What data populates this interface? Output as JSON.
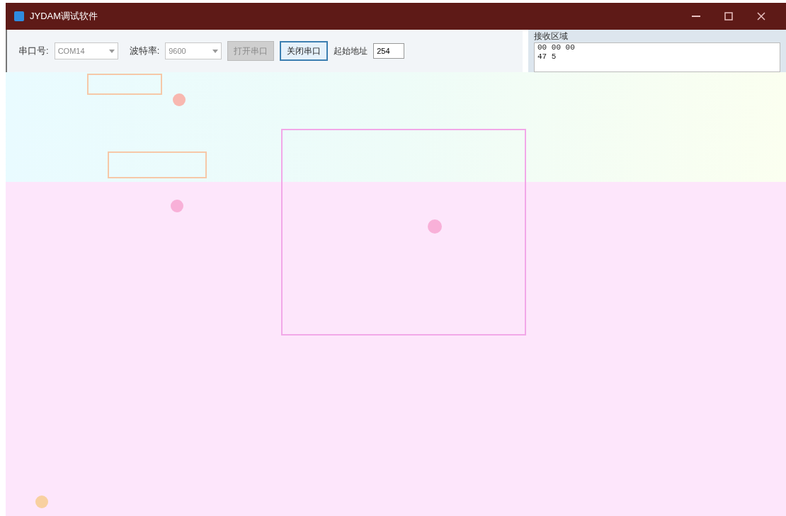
{
  "window": {
    "title": "JYDAM调试软件"
  },
  "toolbar": {
    "port_label": "串口号:",
    "port_value": "COM14",
    "baud_label": "波特率:",
    "baud_value": "9600",
    "buttons": [
      {
        "label": "打开串口",
        "disabled": true
      },
      {
        "label": "关闭串口",
        "disabled": false
      }
    ],
    "address_label": "起始地址",
    "address_value": "254"
  },
  "receive": {
    "title": "接收区域",
    "lines": [
      "00 00 00",
      "47 5"
    ]
  }
}
